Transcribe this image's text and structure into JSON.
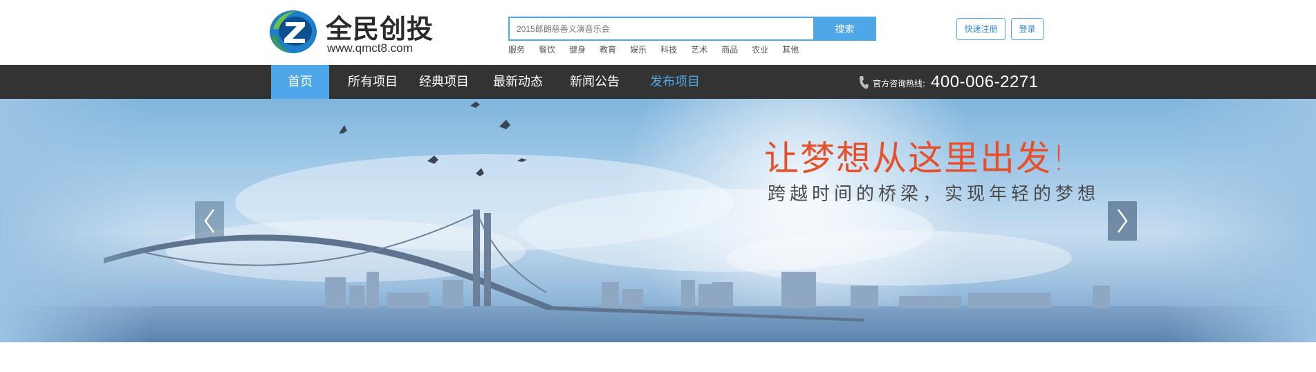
{
  "header": {
    "logo_name": "全民创投",
    "logo_url": "www.qmct8.com",
    "search": {
      "placeholder": "2015郎朗慈善义演音乐会",
      "button_label": "搜索"
    },
    "hot_tags": [
      "服务",
      "餐饮",
      "健身",
      "教育",
      "娱乐",
      "科技",
      "艺术",
      "商品",
      "农业",
      "其他"
    ],
    "register_label": "快速注册",
    "login_label": "登录"
  },
  "nav": {
    "items": [
      {
        "label": "首页",
        "state": "active"
      },
      {
        "label": "所有项目"
      },
      {
        "label": "经典项目"
      },
      {
        "label": "最新动态"
      },
      {
        "label": "新闻公告"
      },
      {
        "label": "发布项目",
        "state": "highlight"
      }
    ],
    "hotline_label": "官方咨询热线:",
    "hotline_number": "400-006-2271"
  },
  "banner": {
    "slogan": "让梦想从这里出发!",
    "sub_slogan": "跨越时间的桥梁，实现年轻的梦想",
    "prev_icon": "chevron-left-icon",
    "next_icon": "chevron-right-icon"
  },
  "colors": {
    "accent": "#4ea7e9",
    "nav_bg": "#333333",
    "slogan": "#e4512b"
  }
}
